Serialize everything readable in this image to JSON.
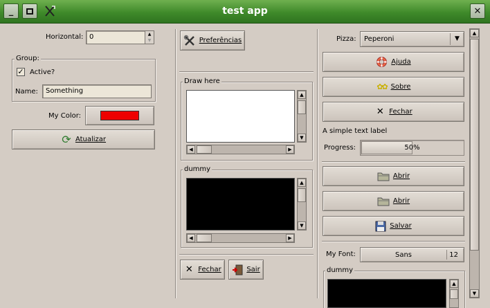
{
  "window": {
    "title": "test app"
  },
  "left": {
    "horizontal_label": "Horizontal:",
    "horizontal_value": "0",
    "group_title": "Group:",
    "active_label": "Active?",
    "active_checked": true,
    "name_label": "Name:",
    "name_value": "Something",
    "color_label": "My Color:",
    "color_value": "#ee0000",
    "refresh_button": "Atualizar"
  },
  "middle": {
    "preferences_button": "Preferências",
    "draw_frame_title": "Draw here",
    "dummy_frame_title": "dummy",
    "close_button": "Fechar",
    "exit_button": "Sair"
  },
  "right": {
    "pizza_label": "Pizza:",
    "pizza_value": "Peperoni",
    "help_button": "Ajuda",
    "about_button": "Sobre",
    "close_button": "Fechar",
    "text_label": "A simple text label",
    "progress_label": "Progress:",
    "progress_value": 0.5,
    "progress_text": "50%",
    "open_button_1": "Abrir",
    "open_button_2": "Abrir",
    "save_button": "Salvar",
    "font_label": "My Font:",
    "font_name": "Sans",
    "font_size": "12",
    "dummy_frame_title": "dummy"
  },
  "colors": {
    "titlebar": "#3f8a2a",
    "background": "#d4ccc4",
    "entry_bg": "#ece6d8",
    "color_swatch": "#ee0000",
    "dummy_canvas": "#000000",
    "draw_canvas": "#ffffff"
  },
  "icons": {
    "preferences": "tools-icon",
    "refresh": "refresh-icon",
    "help": "lifebuoy-icon",
    "about": "stars-icon",
    "close": "x-icon",
    "exit": "exit-door-icon",
    "open": "folder-icon",
    "save": "floppy-icon"
  }
}
